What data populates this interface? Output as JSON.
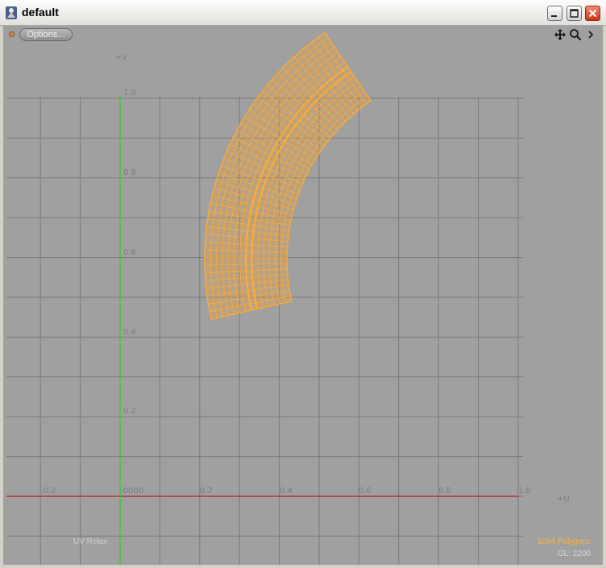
{
  "window": {
    "title": "default",
    "icon": "app-icon"
  },
  "toolbar": {
    "options_label": "Options...",
    "icons": [
      "move-icon",
      "zoom-icon",
      "more-icon"
    ]
  },
  "uv_view": {
    "v_axis_label": "+V",
    "u_axis_label": "+U",
    "v_tick_labels": [
      "1.0",
      "0.8",
      "0.6",
      "0.4",
      "0.2"
    ],
    "u_tick_labels": [
      "-0.2",
      "-0000",
      "0.2",
      "0.4",
      "0.6",
      "0.8",
      "1.0"
    ],
    "grid_color": "#7a7a7a",
    "u_axis_color": "#b22222",
    "v_axis_color": "#33cc33",
    "mesh_color": "#ffaa33",
    "background": "#a0a0a0"
  },
  "status": {
    "mode": "UV Relax",
    "polygons": "1094 Polygons",
    "gl": "GL: 2200"
  }
}
